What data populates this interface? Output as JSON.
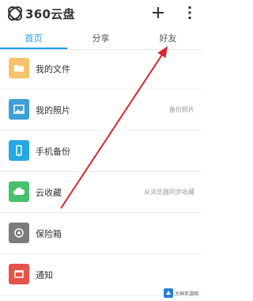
{
  "app": {
    "logo_text": "360云盘"
  },
  "tabs": [
    {
      "label": "首页",
      "active": true
    },
    {
      "label": "分享",
      "active": false
    },
    {
      "label": "好友",
      "active": false
    }
  ],
  "list": [
    {
      "label": "我的文件",
      "hint": "",
      "icon": "folder-icon",
      "color": "#f6c36b"
    },
    {
      "label": "我的照片",
      "hint": "备份照片",
      "icon": "photo-icon",
      "color": "#3e9fd6"
    },
    {
      "label": "手机备份",
      "hint": "",
      "icon": "phone-icon",
      "color": "#24a7e3"
    },
    {
      "label": "云收藏",
      "hint": "从浏览器同步收藏",
      "icon": "cloud-icon",
      "color": "#49c06e"
    },
    {
      "label": "保险箱",
      "hint": "",
      "icon": "safe-icon",
      "color": "#7c7c7c"
    },
    {
      "label": "通知",
      "hint": "",
      "icon": "notice-icon",
      "color": "#e5534b"
    }
  ],
  "watermark": {
    "text": "大神手游网"
  },
  "colors": {
    "accent": "#1f9be8",
    "annotation": "#d7262e"
  }
}
